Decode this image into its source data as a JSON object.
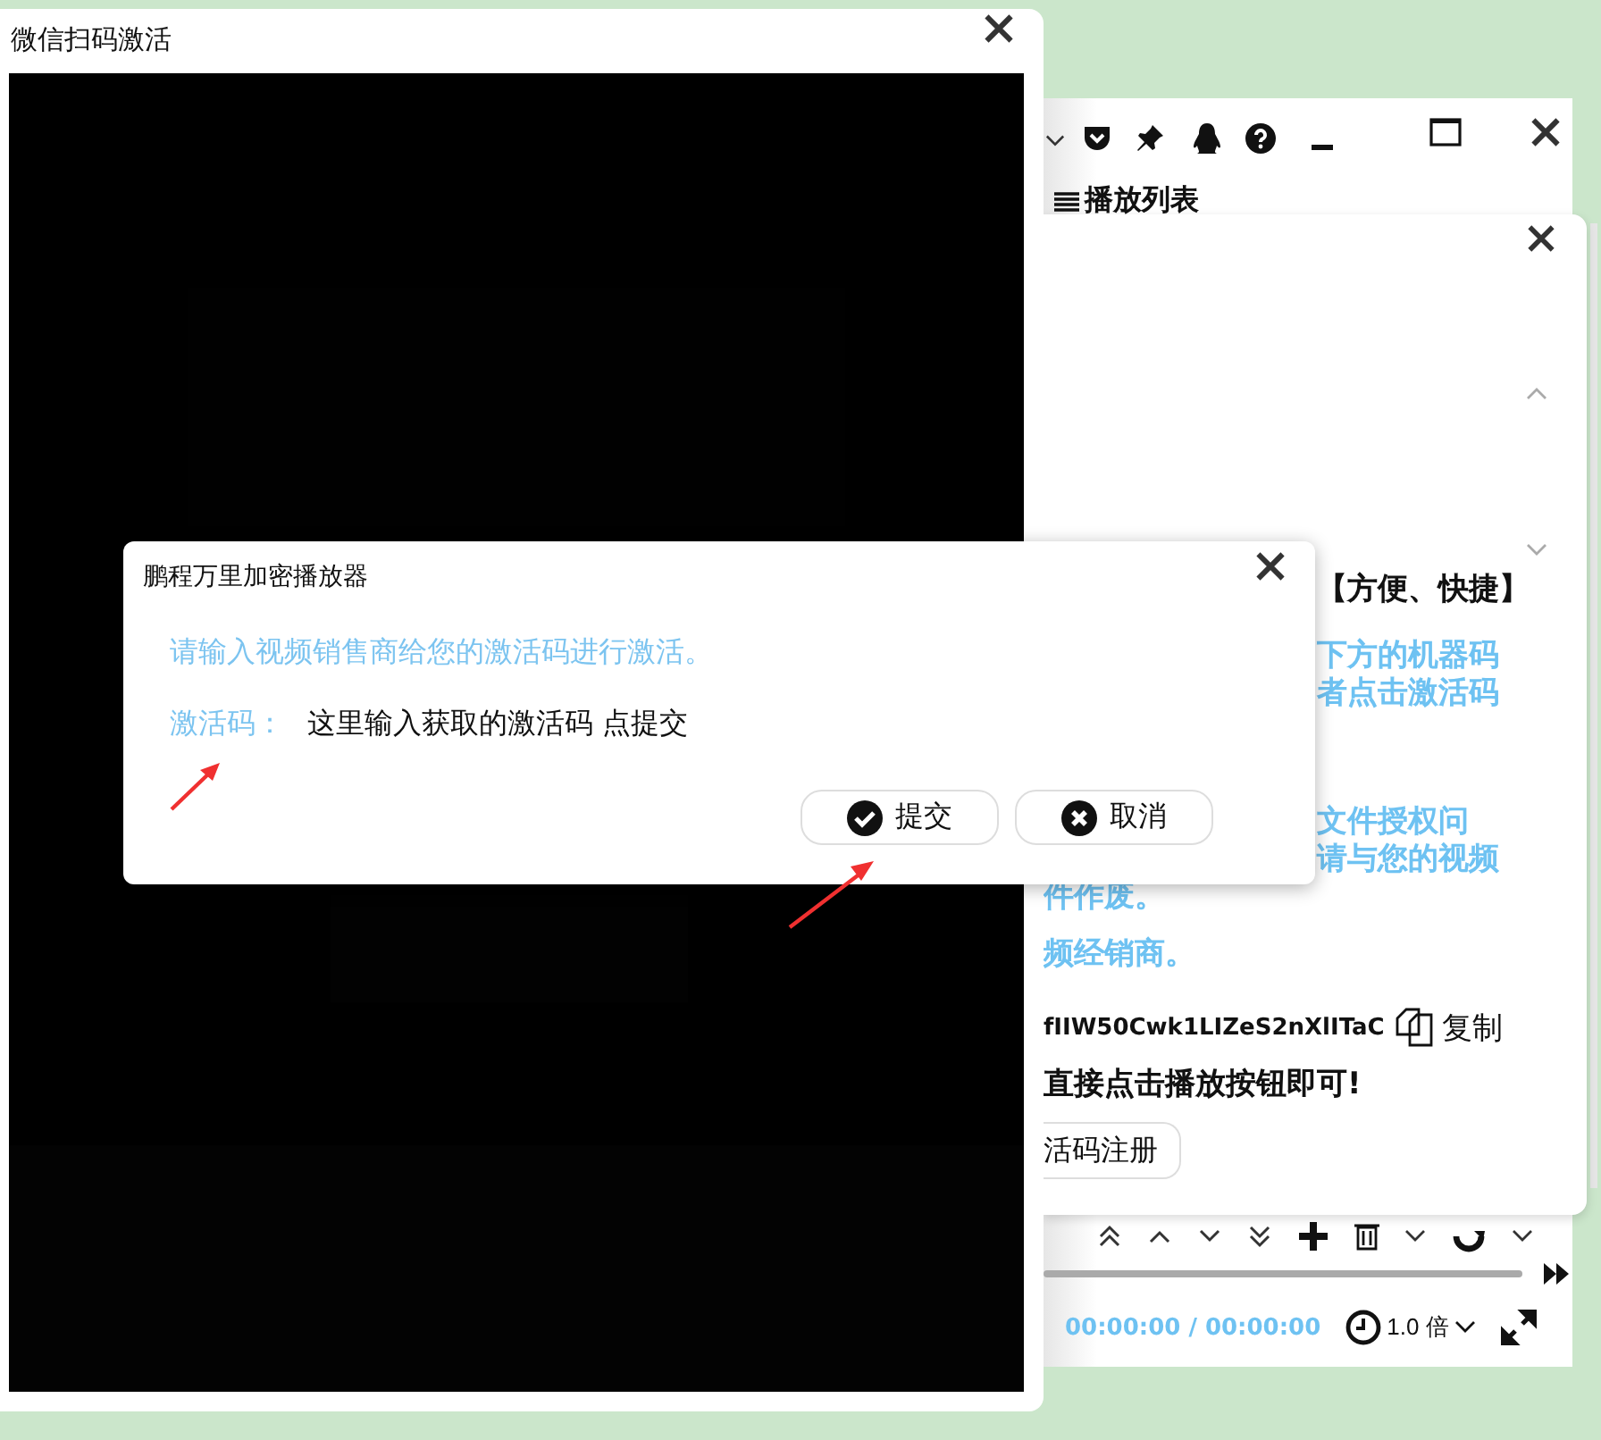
{
  "player_window": {
    "menu_title": "播放列表",
    "playlist_panel": {
      "paragraphs": [
        {
          "kind": "heading",
          "lines": [
            "【方便、快捷】"
          ]
        },
        {
          "kind": "note",
          "lines": [
            "下方的机器码",
            "者点击激活码"
          ]
        },
        {
          "kind": "note",
          "lines": [
            "文件授权问",
            "请与您的视频",
            "件作废。"
          ]
        },
        {
          "kind": "note",
          "lines": [
            "频经销商。"
          ]
        }
      ],
      "machine_code": "fIIW50Cwk1LIZeS2nXlITaC",
      "copy_label": "复制",
      "hint": "直接点击播放按钮即可!",
      "register_button": "活码注册"
    },
    "time": "00:00:00 / 00:00:00",
    "speed": "1.0 倍"
  },
  "wechat_window": {
    "title": "微信扫码激活"
  },
  "dialog": {
    "title": "鹏程万里加密播放器",
    "message": "请输入视频销售商给您的激活码进行激活。",
    "field_label": "激活码：",
    "field_value": "这里输入获取的激活码 点提交",
    "buttons": [
      {
        "kind": "submit",
        "label": "提交"
      },
      {
        "kind": "cancel",
        "label": "取消"
      }
    ]
  }
}
